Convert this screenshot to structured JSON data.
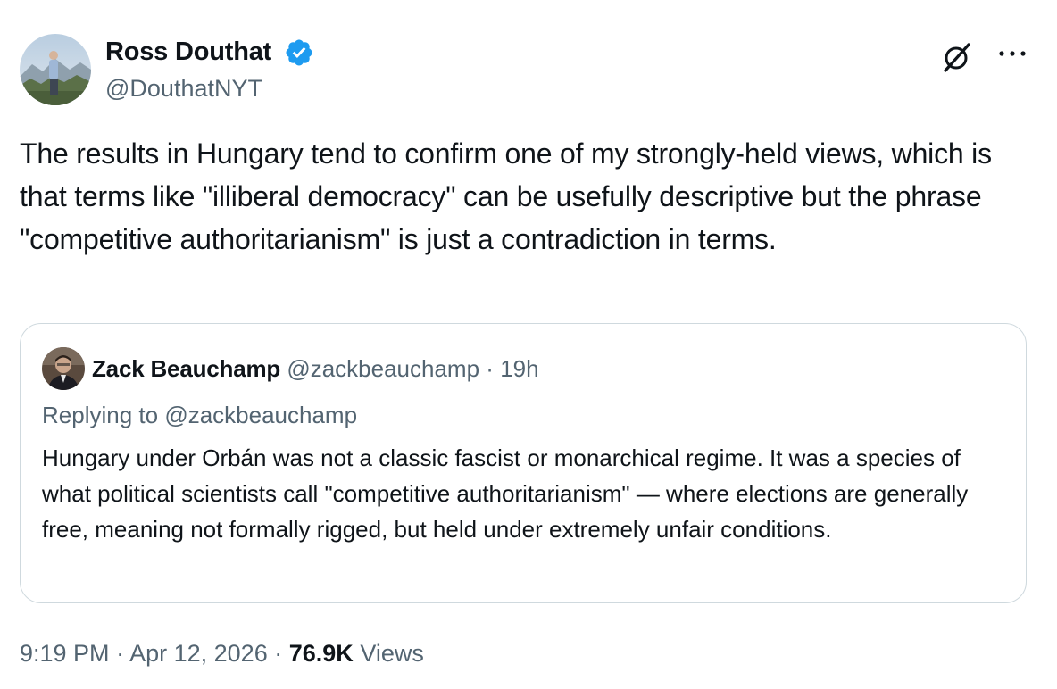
{
  "author": {
    "name": "Ross Douthat",
    "handle": "@DouthatNYT",
    "verified": true,
    "avatar_icon": "profile-photo-icon"
  },
  "header_actions": {
    "grok_icon": "grok-icon",
    "more_icon": "more-options-icon"
  },
  "tweet": {
    "text": "The results in Hungary tend to confirm one of my strongly-held views, which is that terms like \"illiberal democracy\" can be usefully descriptive but the phrase \"competitive authoritarianism\" is just a contradiction in terms."
  },
  "quote": {
    "name": "Zack Beauchamp",
    "handle": "@zackbeauchamp",
    "separator": "·",
    "time": "19h",
    "replying_prefix": "Replying to ",
    "replying_to": "@zackbeauchamp",
    "text": "Hungary under Orbán was not a classic fascist or monarchical regime. It was a species of what political scientists call \"competitive authoritarianism\" — where elections are generally free, meaning not formally rigged, but held under extremely unfair conditions."
  },
  "meta": {
    "time": "9:19 PM",
    "sep1": "·",
    "date": "Apr 12, 2026",
    "sep2": "·",
    "views_count": "76.9K",
    "views_label": "Views"
  },
  "colors": {
    "text_primary": "#0f1419",
    "text_secondary": "#536471",
    "verified_blue": "#1d9bf0",
    "border": "#cfd9de"
  }
}
